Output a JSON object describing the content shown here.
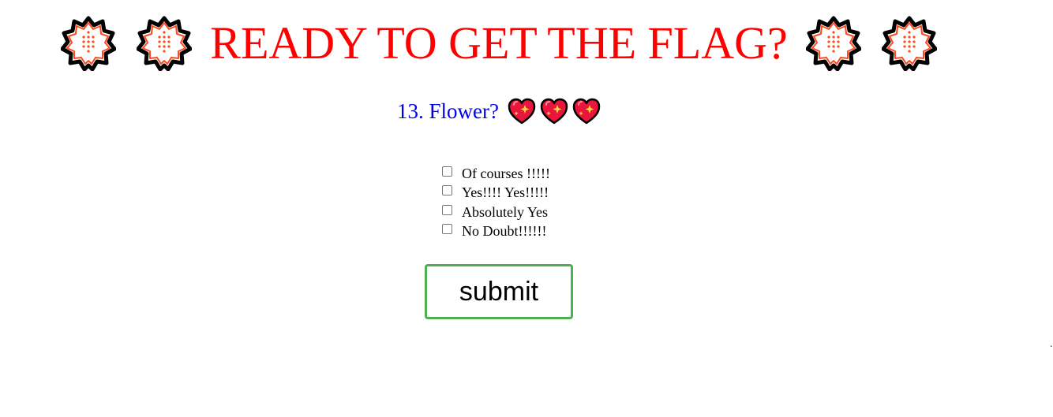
{
  "header": {
    "title": "READY TO GET THE FLAG?",
    "title_color": "#ff0000",
    "decoration_icon": "cherry-blossom-icon"
  },
  "question": {
    "text": "13. Flower?",
    "color": "#0000ee",
    "decoration_icon": "sparkling-heart-icon"
  },
  "options": [
    {
      "label": "Of courses !!!!!",
      "checked": false
    },
    {
      "label": "Yes!!!! Yes!!!!!",
      "checked": false
    },
    {
      "label": "Absolutely Yes",
      "checked": false
    },
    {
      "label": "No Doubt!!!!!!",
      "checked": false
    }
  ],
  "submit": {
    "label": "submit",
    "border_color": "#4caf50"
  },
  "footer": {
    "dot": "."
  }
}
